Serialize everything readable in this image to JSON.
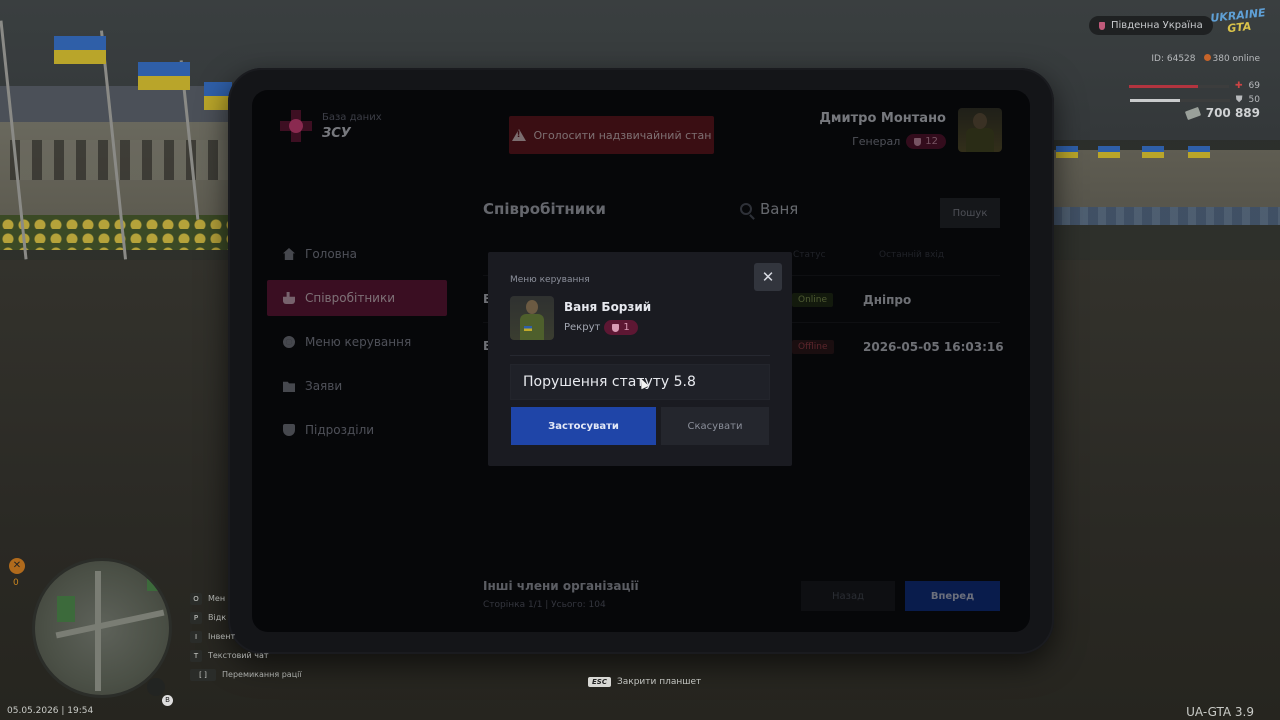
{
  "tablet": {
    "db_label": "База даних",
    "org_name": "ЗСУ",
    "alert_button": "Оголосити надзвичайний стан",
    "user": {
      "name": "Дмитро Монтано",
      "rank": "Генерал",
      "rank_level": "12"
    },
    "nav": [
      {
        "label": "Головна",
        "icon": "home-icon"
      },
      {
        "label": "Співробітники",
        "icon": "users-icon",
        "active": true
      },
      {
        "label": "Меню керування",
        "icon": "gear-icon"
      },
      {
        "label": "Заяви",
        "icon": "folder-icon"
      },
      {
        "label": "Підрозділи",
        "icon": "shield-icon"
      }
    ],
    "main": {
      "title": "Співробітники",
      "search_value": "Ваня",
      "search_button": "Пошук",
      "columns": {
        "status": "Статус",
        "last_login": "Останній вхід"
      },
      "rows": [
        {
          "name_partial": "В",
          "status": "Online",
          "last_login": "Дніпро"
        },
        {
          "name_partial": "В",
          "status": "Offline",
          "last_login": "2026-05-05 16:03:16"
        }
      ],
      "footer_title": "Інші члени організації",
      "footer_sub": "Сторінка 1/1 | Усього: 104",
      "back_button": "Назад",
      "next_button": "Вперед"
    },
    "modal": {
      "title": "Меню керування",
      "close": "✕",
      "member_name": "Ваня Борзий",
      "member_rank": "Рекрут",
      "member_rank_level": "1",
      "reason_value": "Порушення статуту 5.8",
      "apply_button": "Застосувати",
      "cancel_button": "Скасувати"
    }
  },
  "hud": {
    "region": "Південна Україна",
    "logo_top": "UKRAINE",
    "logo_bottom": "GTA",
    "id": "ID: 64528",
    "online": "380 online",
    "health": "69",
    "armor": "50",
    "health_fraction": 0.69,
    "armor_fraction": 0.5,
    "money": "700 889",
    "datetime": "05.05.2026 | 19:54",
    "esc_key": "ESC",
    "esc_hint": "Закрити планшет",
    "version": "UA-GTA 3.9",
    "counter": "0",
    "mic_badge": "B",
    "hints": [
      {
        "key": "O",
        "label": "Мен"
      },
      {
        "key": "P",
        "label": "Відк"
      },
      {
        "key": "I",
        "label": "Інвент"
      },
      {
        "key": "T",
        "label": "Текстовий чат"
      },
      {
        "key": "[ ]",
        "label": "Перемикання рації"
      }
    ]
  },
  "colors": {
    "accent": "#6a1a3f",
    "alert": "#6a1a24",
    "primary_button": "#1f45a8",
    "online": "#8da35a",
    "offline": "#a4444f"
  }
}
